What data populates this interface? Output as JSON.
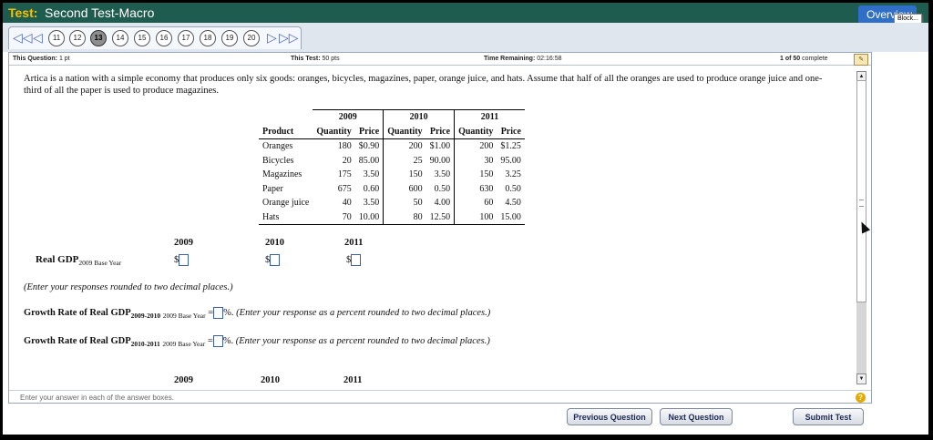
{
  "header": {
    "label": "Test:",
    "title": "Second Test-Macro",
    "overview_label": "Overview",
    "tooltip": "Block..."
  },
  "nav": {
    "question_numbers": [
      "11",
      "12",
      "13",
      "14",
      "15",
      "16",
      "17",
      "18",
      "19",
      "20"
    ],
    "current": "13"
  },
  "info": {
    "this_question_label": "This Question:",
    "this_question_value": "1 pt",
    "this_test_label": "This Test:",
    "this_test_value": "50 pts",
    "time_label": "Time Remaining:",
    "time_value": "02:16:58",
    "progress": "1 of 50",
    "complete_label": "complete"
  },
  "question": {
    "text": "Artica is a nation with a simple economy that produces only six goods: oranges, bicycles, magazines, paper, orange juice, and hats. Assume that half of all the oranges are used to produce orange juice and one-third of all the paper is used to produce magazines."
  },
  "table": {
    "years": [
      "2009",
      "2010",
      "2011"
    ],
    "product_header": "Product",
    "quantity_header": "Quantity",
    "price_header": "Price",
    "rows": [
      {
        "product": "Oranges",
        "q2009": "180",
        "p2009": "$0.90",
        "q2010": "200",
        "p2010": "$1.00",
        "q2011": "200",
        "p2011": "$1.25"
      },
      {
        "product": "Bicycles",
        "q2009": "20",
        "p2009": "85.00",
        "q2010": "25",
        "p2010": "90.00",
        "q2011": "30",
        "p2011": "95.00"
      },
      {
        "product": "Magazines",
        "q2009": "175",
        "p2009": "3.50",
        "q2010": "150",
        "p2010": "3.50",
        "q2011": "150",
        "p2011": "3.25"
      },
      {
        "product": "Paper",
        "q2009": "675",
        "p2009": "0.60",
        "q2010": "600",
        "p2010": "0.50",
        "q2011": "630",
        "p2011": "0.50"
      },
      {
        "product": "Orange juice",
        "q2009": "40",
        "p2009": "3.50",
        "q2010": "50",
        "p2010": "4.00",
        "q2011": "60",
        "p2011": "4.50"
      },
      {
        "product": "Hats",
        "q2009": "70",
        "p2009": "10.00",
        "q2010": "80",
        "p2010": "12.50",
        "q2011": "100",
        "p2011": "15.00"
      }
    ]
  },
  "answers": {
    "years": [
      "2009",
      "2010",
      "2011"
    ],
    "real_gdp_label": "Real GDP",
    "real_gdp_sub": "2009 Base Year",
    "currency": "$",
    "note": "(Enter your responses rounded to two decimal places.)",
    "growth_label": "Growth Rate of Real GDP",
    "growth1_period": "2009-2010",
    "growth2_period": "2010-2011",
    "base_year": "2009 Base Year",
    "equals": "=",
    "percent": "%.",
    "growth_instruction": "(Enter your response as a percent rounded to two decimal places.)",
    "bottom_years": [
      "2009",
      "2010",
      "2011"
    ]
  },
  "footer": {
    "hint": "Enter your answer in each of the answer boxes.",
    "help": "?"
  },
  "buttons": {
    "previous": "Previous Question",
    "next": "Next Question",
    "submit": "Submit Test"
  }
}
